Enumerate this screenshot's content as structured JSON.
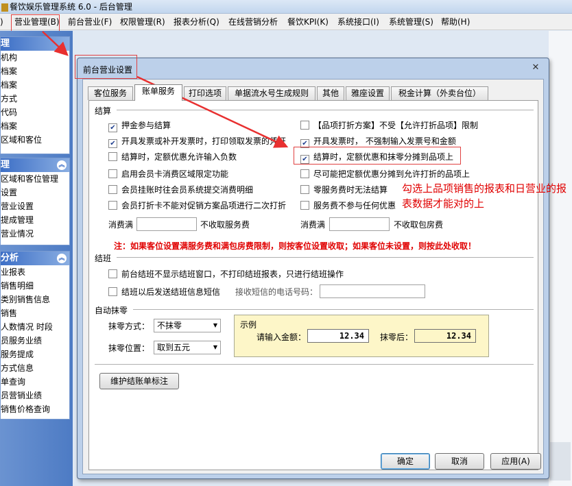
{
  "app": {
    "title": "餐饮娱乐管理系统 6.0 - 后台管理"
  },
  "menubar": {
    "items": [
      {
        "label": ")"
      },
      {
        "label": "营业管理(B)"
      },
      {
        "label": "前台营业(F)"
      },
      {
        "label": "权限管理(R)"
      },
      {
        "label": "报表分析(Q)"
      },
      {
        "label": "在线营销分析"
      },
      {
        "label": "餐饮KPI(K)"
      },
      {
        "label": "系统接口(I)"
      },
      {
        "label": "系统管理(S)"
      },
      {
        "label": "帮助(H)"
      }
    ]
  },
  "sidebar": {
    "panel1": {
      "header": "理",
      "items": [
        "机构",
        "档案",
        "档案",
        "方式",
        "代码",
        "档案",
        "区域和客位"
      ]
    },
    "panel2": {
      "header": "理",
      "items": [
        "区域和客位管理",
        "设置",
        "营业设置",
        "提成管理",
        "营业情况"
      ]
    },
    "panel3": {
      "header": "分析",
      "items": [
        "业报表",
        "销售明细",
        "类别销售信息",
        "销售",
        "人数情况 时段",
        "员服务业绩",
        "服务提成",
        "方式信息",
        "单查询",
        "员营销业绩",
        "销售价格查询"
      ]
    }
  },
  "dialog": {
    "title": "前台营业设置",
    "close": "✕",
    "tabs": [
      {
        "label": "客位服务"
      },
      {
        "label": "账单服务"
      },
      {
        "label": "打印选项"
      },
      {
        "label": "单据流水号生成规则"
      },
      {
        "label": "其他"
      },
      {
        "label": "雅座设置"
      },
      {
        "label": "税金计算（外卖台位）"
      }
    ],
    "settlement": {
      "title": "结算",
      "left": [
        {
          "label": "押金参与结算",
          "checked": true
        },
        {
          "label": "开具发票或补开发票时，打印领取发票的凭证",
          "checked": true
        },
        {
          "label": "结算时，定额优惠允许输入负数",
          "checked": false
        },
        {
          "label": "启用会员卡消费区域限定功能",
          "checked": false
        },
        {
          "label": "会员挂账时往会员系统提交消费明细",
          "checked": false
        },
        {
          "label": "会员打折卡不能对促销方案品项进行二次打折",
          "checked": false
        }
      ],
      "right": [
        {
          "label": "【品项打折方案】不受【允许打折品项】限制",
          "checked": false
        },
        {
          "label": "开具发票时， 不强制输入发票号和金额",
          "checked": true
        },
        {
          "label": "结算时，定额优惠和抹零分摊到品项上",
          "checked": true
        },
        {
          "label": "尽可能把定额优惠分摊到允许打折的品项上",
          "checked": false
        },
        {
          "label": "零服务费时无法结算",
          "checked": false
        },
        {
          "label": "服务费不参与任何优惠",
          "checked": false
        }
      ],
      "min_spend_label1": "消费满",
      "no_service_fee": "不收取服务费",
      "min_spend_label2": "消费满",
      "no_room_fee": "不收取包房费",
      "notice": "注：如果客位设置满服务费和满包房费限制，则按客位设置收取；如果客位未设置，则按此处收取！"
    },
    "shift": {
      "title": "结班",
      "items": [
        {
          "label": "前台结班不显示结班窗口，不打印结班报表，只进行结班操作",
          "checked": false
        },
        {
          "label": "结班以后发送结班信息短信",
          "checked": false
        }
      ],
      "phone_label": "接收短信的电话号码："
    },
    "rounding": {
      "title": "自动抹零",
      "mode_label": "抹零方式：",
      "mode_value": "不抹零",
      "position_label": "抹零位置：",
      "position_value": "取到五元",
      "example_title": "示例",
      "amount_label": "请输入金额：",
      "amount_value": "12.34",
      "after_label": "抹零后：",
      "after_value": "12.34"
    },
    "maintain_button": "维护结账单标注",
    "buttons": {
      "ok": "确定",
      "cancel": "取消",
      "apply": "应用(A)"
    }
  },
  "annotation": {
    "text": "勾选上品项销售的报表和日营业的报表数据才能对的上",
    "color": "#e00000"
  }
}
